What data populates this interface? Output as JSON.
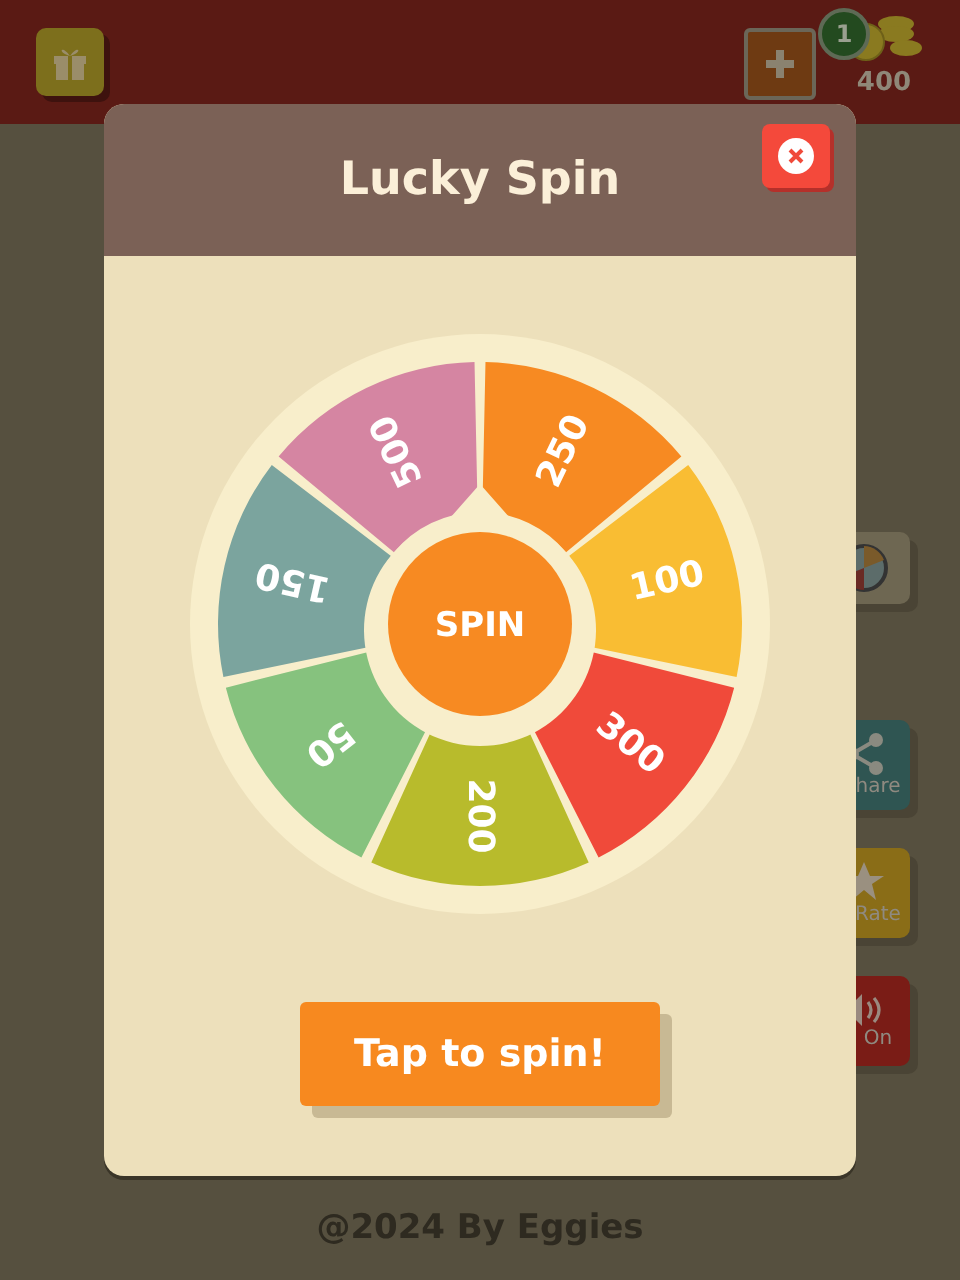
{
  "top_bar": {
    "add_button": {
      "badge": "1"
    },
    "coins": "400"
  },
  "side_buttons": [
    {
      "kind": "wheel"
    },
    {
      "kind": "share",
      "label": "hare"
    },
    {
      "kind": "rate",
      "label": "Rate"
    },
    {
      "kind": "sound",
      "label": "On"
    }
  ],
  "dialog": {
    "title": "Lucky Spin",
    "wheel": {
      "center_label": "SPIN",
      "segments": [
        {
          "label": "250",
          "color": "#f78a22"
        },
        {
          "label": "100",
          "color": "#f9bd33"
        },
        {
          "label": "300",
          "color": "#f04a3a"
        },
        {
          "label": "200",
          "color": "#b8bb2c"
        },
        {
          "label": "50",
          "color": "#86c27e"
        },
        {
          "label": "150",
          "color": "#7ba49e"
        },
        {
          "label": "500",
          "color": "#d585a2"
        }
      ]
    },
    "button": "Tap to spin!"
  },
  "footer": "@2024 By Eggies"
}
